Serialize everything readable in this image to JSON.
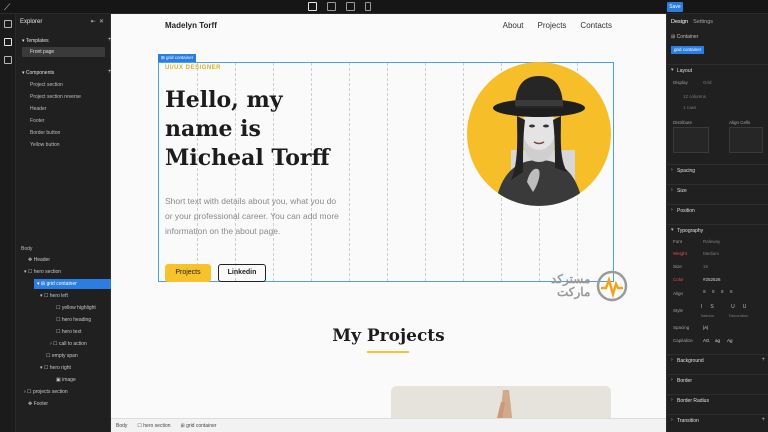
{
  "topbar": {
    "save_label": "Save"
  },
  "explorer": {
    "title": "Explorer",
    "templates_label": "Templates",
    "templates": [
      "Front page"
    ],
    "components_label": "Components",
    "components": [
      "Project section",
      "Project section reverse",
      "Header",
      "Footer",
      "Border button",
      "Yellow button"
    ],
    "tree_label": "Body",
    "tree": [
      {
        "label": "Header",
        "depth": 1
      },
      {
        "label": "hero section",
        "depth": 1
      },
      {
        "label": "grid container",
        "depth": 2,
        "selected": true
      },
      {
        "label": "hero left",
        "depth": 3
      },
      {
        "label": "yellow highlight",
        "depth": 4
      },
      {
        "label": "hero heading",
        "depth": 4
      },
      {
        "label": "hero text",
        "depth": 4
      },
      {
        "label": "call to action",
        "depth": 4
      },
      {
        "label": "empty span",
        "depth": 3
      },
      {
        "label": "hero right",
        "depth": 3
      },
      {
        "label": "image",
        "depth": 4
      },
      {
        "label": "projects section",
        "depth": 1
      },
      {
        "label": "Footer",
        "depth": 1
      }
    ]
  },
  "canvas": {
    "site_name": "Madelyn Torff",
    "nav": [
      "About",
      "Projects",
      "Contacts"
    ],
    "grid_tag": "grid container",
    "highlight": "UI/UX DESIGNER",
    "heading_lines": [
      "Hello, my",
      "name is",
      "Micheal Torff"
    ],
    "hero_text": "Short text with details about you, what you do or your professional career. You can add more information on the about page.",
    "btn_projects": "Projects",
    "btn_linkedin": "Linkedin",
    "projects_title": "My Projects",
    "watermark_lines": [
      "مسترکد",
      "مارکت"
    ]
  },
  "breadcrumb": [
    "Body",
    "hero section",
    "grid container"
  ],
  "right_panel": {
    "tabs": [
      "Design",
      "Settings"
    ],
    "container_label": "Container",
    "badge": "grid container",
    "layout_title": "Layout",
    "display_label": "Display",
    "display_value": "Grid",
    "columns_value": "12 columns",
    "rows_value": "1 rows",
    "distribute_label": "Distribute",
    "align_cells_label": "Align Cells",
    "sections": [
      "Spacing",
      "Size",
      "Position"
    ],
    "typography_title": "Typography",
    "font_label": "Font",
    "font_value": "Raleway",
    "weight_label": "Weight",
    "weight_value": "Medium",
    "size_label": "Size",
    "size_value": "16",
    "color_label": "Color",
    "color_value": "#252526",
    "align_label": "Align",
    "style_label": "Style",
    "style_italic": "Italicize",
    "style_decoration": "Decoration",
    "spacing_label": "Spacing",
    "capitalize_label": "Capitalize",
    "capitalize_options": [
      "AG",
      "ag",
      "Ag"
    ],
    "bottom_sections": [
      "Background",
      "Border",
      "Border Radius",
      "Transition"
    ]
  },
  "colors": {
    "accent": "#2a7de1",
    "brand_yellow": "#f7c22c"
  }
}
